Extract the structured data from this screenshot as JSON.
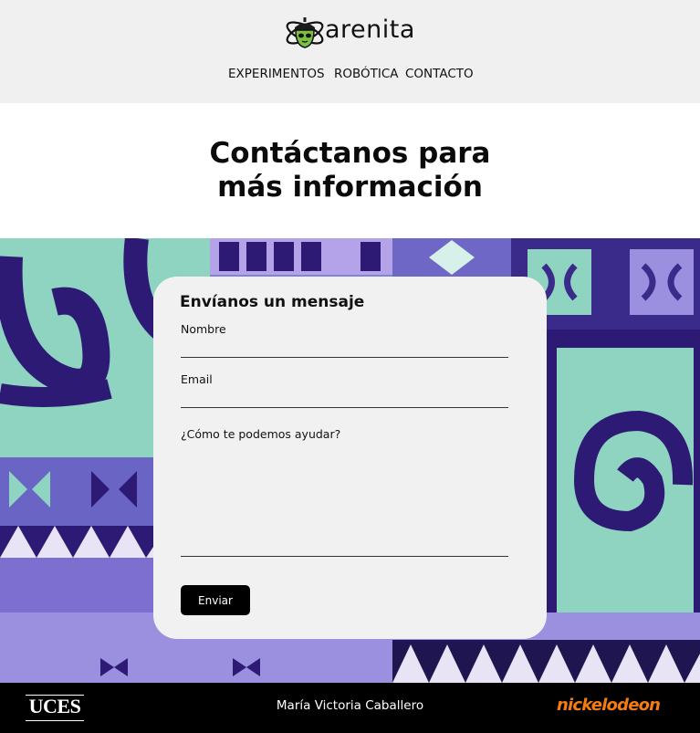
{
  "brand": {
    "name": "arenita",
    "logo_icon": "acorn-atom-icon",
    "accent_color": "#7bc043"
  },
  "nav": {
    "items": [
      {
        "label": "EXPERIMENTOS"
      },
      {
        "label": "ROBÓTICA"
      },
      {
        "label": "CONTACTO"
      }
    ]
  },
  "hero": {
    "line1": "Contáctanos para",
    "line2": "más información"
  },
  "form": {
    "title": "Envíanos un mensaje",
    "name_label": "Nombre",
    "name_value": "",
    "email_label": "Email",
    "email_value": "",
    "help_label": "¿Cómo te podemos ayudar?",
    "help_value": "",
    "submit_label": "Enviar"
  },
  "footer": {
    "left_logo": "UCES",
    "author": "María Victoria Caballero",
    "right_logo": "nickelodeon",
    "right_logo_color": "#f57c12"
  }
}
